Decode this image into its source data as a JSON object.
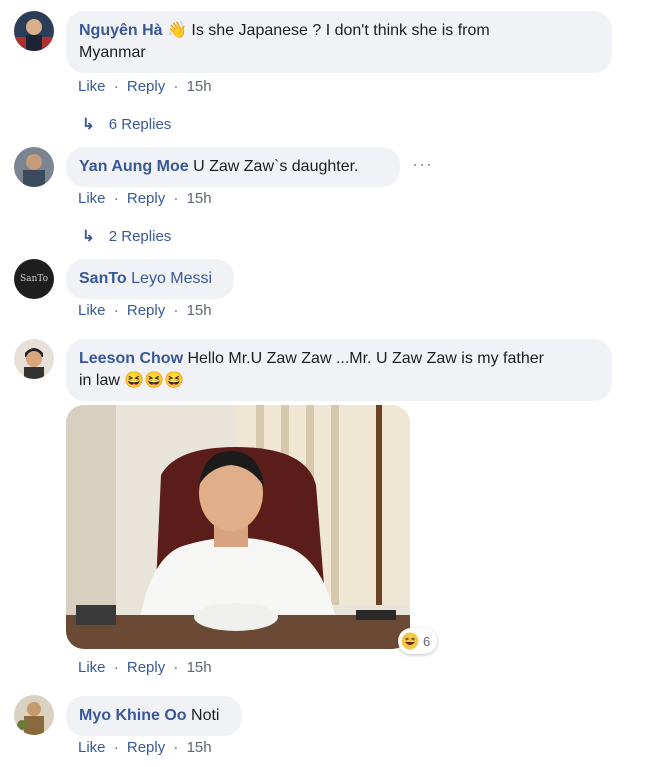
{
  "comments": [
    {
      "author": "Nguyên Hà",
      "text_line1": "Is she Japanese ? I don't think she is from",
      "text_line2": "Myanmar"
    },
    {
      "author": "Yan Aung Moe",
      "text": "U Zaw Zaw`s daughter."
    },
    {
      "author": "SanTo",
      "text": "Leyo Messi",
      "avatar_text": "SanTo"
    },
    {
      "author": "Leeson Chow",
      "text_line1": "Hello Mr.U Zaw Zaw ...Mr. U Zaw Zaw is my father",
      "text_line2_prefix": "in law",
      "text_line2_emoji": "😆😆😆"
    },
    {
      "author": "Myo Khine Oo",
      "text": "Noti"
    }
  ],
  "actions": {
    "like": "Like",
    "reply": "Reply",
    "sep": "·",
    "time": "15h"
  },
  "replies": [
    {
      "label": "6 Replies"
    },
    {
      "label": "2 Replies"
    }
  ],
  "more_label": "···",
  "reaction": {
    "count": "6",
    "icon": "haha-icon"
  },
  "colors": {
    "link": "#385898",
    "bubble": "#f0f2f5",
    "meta": "#606770"
  }
}
